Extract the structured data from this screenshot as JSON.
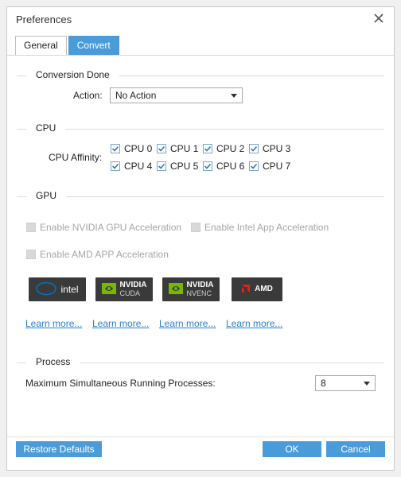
{
  "window": {
    "title": "Preferences"
  },
  "tabs": [
    {
      "label": "General",
      "active": false
    },
    {
      "label": "Convert",
      "active": true
    }
  ],
  "conversion_done": {
    "heading": "Conversion Done",
    "action_label": "Action:",
    "action_value": "No Action"
  },
  "cpu": {
    "heading": "CPU",
    "affinity_label": "CPU Affinity:",
    "items": [
      {
        "label": "CPU 0",
        "checked": true
      },
      {
        "label": "CPU 1",
        "checked": true
      },
      {
        "label": "CPU 2",
        "checked": true
      },
      {
        "label": "CPU 3",
        "checked": true
      },
      {
        "label": "CPU 4",
        "checked": true
      },
      {
        "label": "CPU 5",
        "checked": true
      },
      {
        "label": "CPU 6",
        "checked": true
      },
      {
        "label": "CPU 7",
        "checked": true
      }
    ]
  },
  "gpu": {
    "heading": "GPU",
    "options": [
      {
        "label": "Enable NVIDIA GPU Acceleration",
        "checked": false,
        "enabled": false
      },
      {
        "label": "Enable Intel App Acceleration",
        "checked": false,
        "enabled": false
      },
      {
        "label": "Enable AMD APP Acceleration",
        "checked": false,
        "enabled": false
      }
    ],
    "badges": [
      {
        "brand": "intel",
        "line1": "intel",
        "line2": ""
      },
      {
        "brand": "nvidia",
        "line1": "NVIDIA",
        "line2": "CUDA"
      },
      {
        "brand": "nvidia",
        "line1": "NVIDIA",
        "line2": "NVENC"
      },
      {
        "brand": "amd",
        "line1": "AMD",
        "line2": ""
      }
    ],
    "links": [
      "Learn more...",
      "Learn more...",
      "Learn more...",
      "Learn more..."
    ]
  },
  "process": {
    "heading": "Process",
    "max_label": "Maximum Simultaneous Running Processes:",
    "max_value": "8"
  },
  "footer": {
    "restore_label": "Restore Defaults",
    "ok_label": "OK",
    "cancel_label": "Cancel"
  },
  "colors": {
    "accent": "#4a9bd9",
    "link": "#2a7fcf",
    "badge_bg": "#3a3a3a",
    "nvidia_green": "#76b900",
    "intel_blue": "#0071c5",
    "amd_red": "#e0201b"
  }
}
